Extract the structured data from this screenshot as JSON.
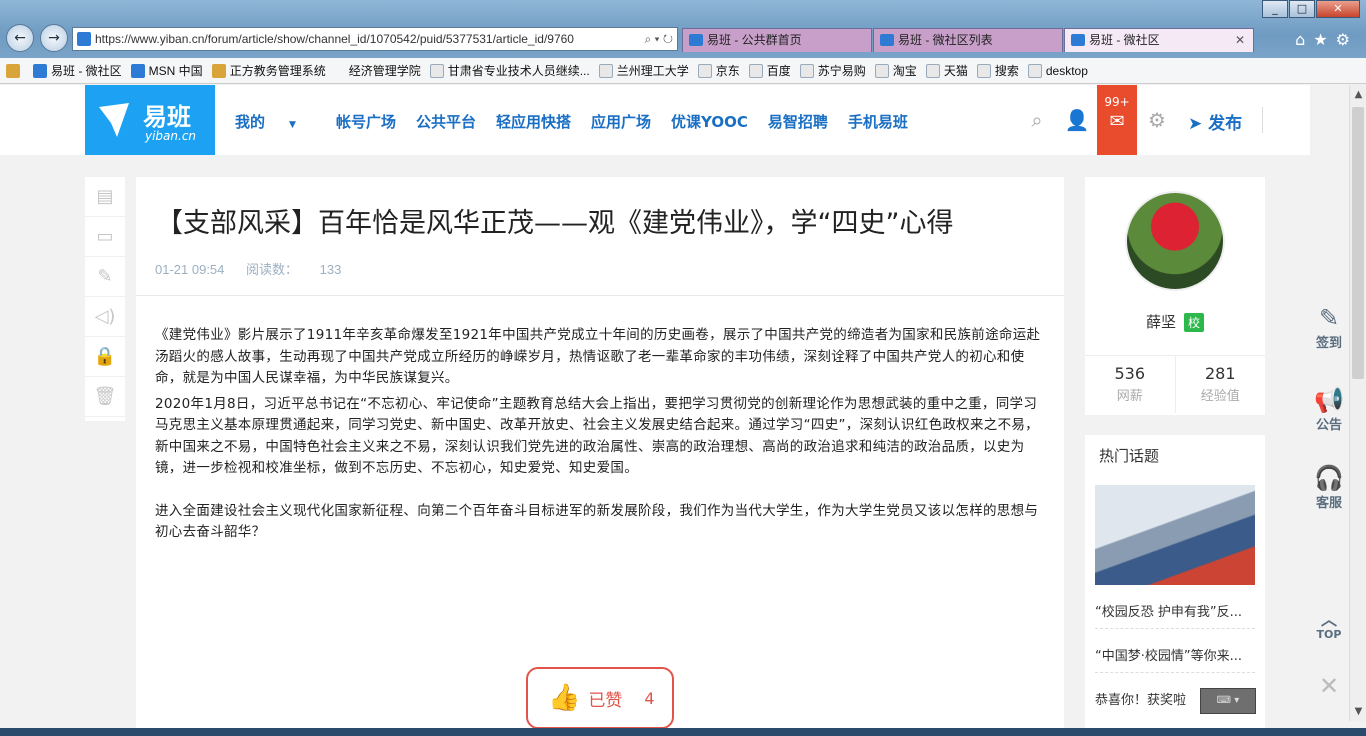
{
  "browser": {
    "url": "https://www.yiban.cn/forum/article/show/channel_id/1070542/puid/5377531/article_id/9760",
    "tabs": [
      {
        "label": "易班 - 公共群首页"
      },
      {
        "label": "易班 - 微社区列表"
      },
      {
        "label": "易班 - 微社区"
      }
    ],
    "favorites": [
      "易班 - 微社区",
      "MSN 中国",
      "正方教务管理系统",
      "经济管理学院",
      "甘肃省专业技术人员继续...",
      "兰州理工大学",
      "京东",
      "百度",
      "苏宁易购",
      "淘宝",
      "天猫",
      "搜索",
      "desktop"
    ]
  },
  "header": {
    "logo_text": "易班",
    "logo_sub": "yiban.cn",
    "nav": [
      "我的",
      "帐号广场",
      "公共平台",
      "轻应用快搭",
      "应用广场",
      "优课YOOC",
      "易智招聘",
      "手机易班"
    ],
    "mail_count": "99+",
    "publish_label": "发布"
  },
  "article": {
    "title": "【支部风采】百年恰是风华正茂——观《建党伟业》，学“四史”心得",
    "time": "01-21 09:54",
    "reads_label": "阅读数：",
    "reads": "133",
    "paragraphs": [
      "《建党伟业》影片展示了1911年辛亥革命爆发至1921年中国共产党成立十年间的历史画卷，展示了中国共产党的缔造者为国家和民族前途命运赴汤蹈火的感人故事，生动再现了中国共产党成立所经历的峥嵘岁月，热情讴歌了老一辈革命家的丰功伟绩，深刻诠释了中国共产党人的初心和使命，就是为中国人民谋幸福，为中华民族谋复兴。",
      "2020年1月8日，习近平总书记在“不忘初心、牢记使命”主题教育总结大会上指出，要把学习贯彻党的创新理论作为思想武装的重中之重，同学习马克思主义基本原理贯通起来，同学习党史、新中国史、改革开放史、社会主义发展史结合起来。通过学习“四史”，深刻认识红色政权来之不易，新中国来之不易，中国特色社会主义来之不易，深刻认识我们党先进的政治属性、崇高的政治理想、高尚的政治追求和纯洁的政治品质，以史为镜，进一步检视和校准坐标，做到不忘历史、不忘初心，知史爱党、知史爱国。",
      "进入全面建设社会主义现代化国家新征程、向第二个百年奋斗目标进军的新发展阶段，我们作为当代大学生，作为大学生党员又该以怎样的思想与初心去奋斗韶华？"
    ],
    "like_label": "已赞",
    "like_count": "4"
  },
  "profile": {
    "name": "薛坚",
    "badge": "校",
    "stats": [
      {
        "value": "536",
        "label": "网薪"
      },
      {
        "value": "281",
        "label": "经验值"
      }
    ]
  },
  "hot": {
    "title": "热门话题",
    "items": [
      "“校园反恐 护申有我”反...",
      "“中国梦·校园情”等你来...",
      "恭喜你！获奖啦"
    ]
  },
  "float_tools": [
    "签到",
    "公告",
    "客服",
    "TOP"
  ]
}
